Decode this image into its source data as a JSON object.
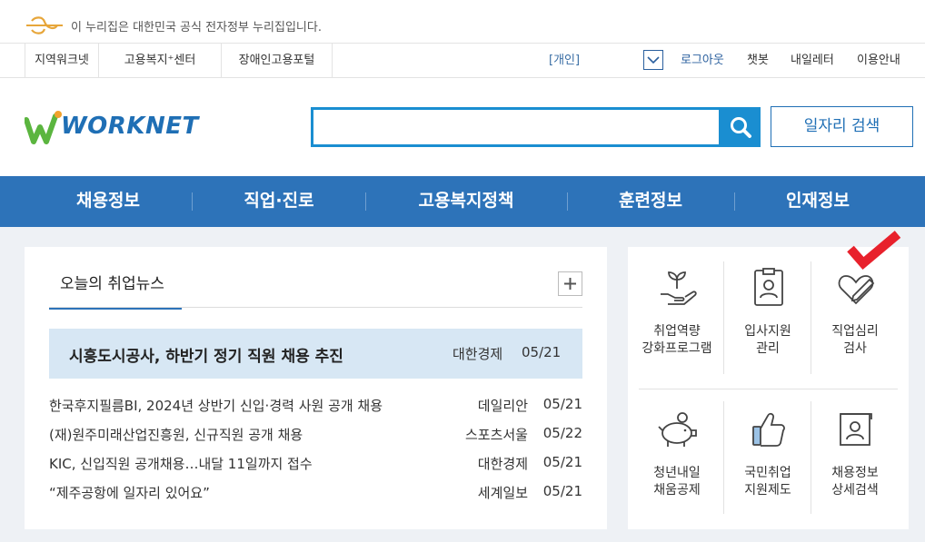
{
  "gov_banner": {
    "text": "이 누리집은 대한민국 공식 전자정부 누리집입니다."
  },
  "util_bar": {
    "left_links": [
      "지역워크넷",
      "고용복지⁺센터",
      "장애인고용포털"
    ],
    "personal": "[개인]",
    "right_links": [
      "로그아웃",
      "챗봇",
      "내일레터",
      "이용안내"
    ]
  },
  "header": {
    "logo_text": "WORKNET",
    "search_value": "",
    "job_search_label": "일자리 검색"
  },
  "nav": {
    "items": [
      "채용정보",
      "직업·진로",
      "고용복지정책",
      "훈련정보",
      "인재정보"
    ]
  },
  "news": {
    "tab": "오늘의 취업뉴스",
    "headline": {
      "title": "시흥도시공사, 하반기 정기 직원 채용 추진",
      "source": "대한경제",
      "date": "05/21"
    },
    "items": [
      {
        "title": "한국후지필름BI, 2024년 상반기 신입·경력 사원 공개 채용",
        "source": "데일리안",
        "date": "05/21"
      },
      {
        "title": "(재)원주미래산업진흥원, 신규직원 공개 채용",
        "source": "스포츠서울",
        "date": "05/22"
      },
      {
        "title": "KIC, 신입직원 공개채용…내달 11일까지 접수",
        "source": "대한경제",
        "date": "05/21"
      },
      {
        "title": "“제주공항에 일자리 있어요”",
        "source": "세계일보",
        "date": "05/21"
      }
    ]
  },
  "quick_links": [
    {
      "line1": "취업역량",
      "line2": "강화프로그램",
      "icon": "plant-hand-icon"
    },
    {
      "line1": "입사지원",
      "line2": "관리",
      "icon": "id-badge-icon"
    },
    {
      "line1": "직업심리",
      "line2": "검사",
      "icon": "heart-pencil-icon"
    },
    {
      "line1": "청년내일",
      "line2": "채움공제",
      "icon": "piggy-bank-icon"
    },
    {
      "line1": "국민취업",
      "line2": "지원제도",
      "icon": "thumbs-up-icon"
    },
    {
      "line1": "채용정보",
      "line2": "상세검색",
      "icon": "profile-document-icon"
    }
  ],
  "colors": {
    "primary": "#2d73b9",
    "search_accent": "#1a8ed1",
    "highlight_bg": "#d7e7f4",
    "check_red": "#e8212c"
  }
}
